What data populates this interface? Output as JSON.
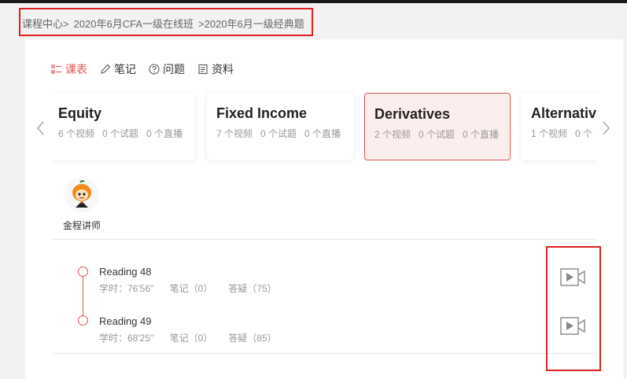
{
  "breadcrumb": {
    "items": [
      "课程中心>",
      "2020年6月CFA一级在线班",
      ">2020年6月一级经典题"
    ]
  },
  "tabs": [
    {
      "label": "课表",
      "icon": "list-icon",
      "active": true
    },
    {
      "label": "笔记",
      "icon": "pencil-icon",
      "active": false
    },
    {
      "label": "问题",
      "icon": "question-icon",
      "active": false
    },
    {
      "label": "资料",
      "icon": "document-icon",
      "active": false
    }
  ],
  "cards": [
    {
      "title": "Equity",
      "videos": "6 个视频",
      "tests": "0 个试题",
      "live": "0 个直播",
      "active": false
    },
    {
      "title": "Fixed Income",
      "videos": "7 个视频",
      "tests": "0 个试题",
      "live": "0 个直播",
      "active": false
    },
    {
      "title": "Derivatives",
      "videos": "2 个视频",
      "tests": "0 个试题",
      "live": "0 个直播",
      "active": true
    },
    {
      "title": "Alternative",
      "videos": "1 个视频",
      "tests": "0 个",
      "live": "",
      "active": false
    }
  ],
  "teacher": {
    "name": "金程讲师"
  },
  "readings": [
    {
      "title": "Reading 48",
      "duration": "学时：76'56''",
      "notes": "笔记（0）",
      "qa": "答疑（75）"
    },
    {
      "title": "Reading 49",
      "duration": "学时：68'25''",
      "notes": "笔记（0）",
      "qa": "答疑（85）"
    }
  ],
  "colors": {
    "accent": "#e35454",
    "annotation": "#e02020"
  }
}
